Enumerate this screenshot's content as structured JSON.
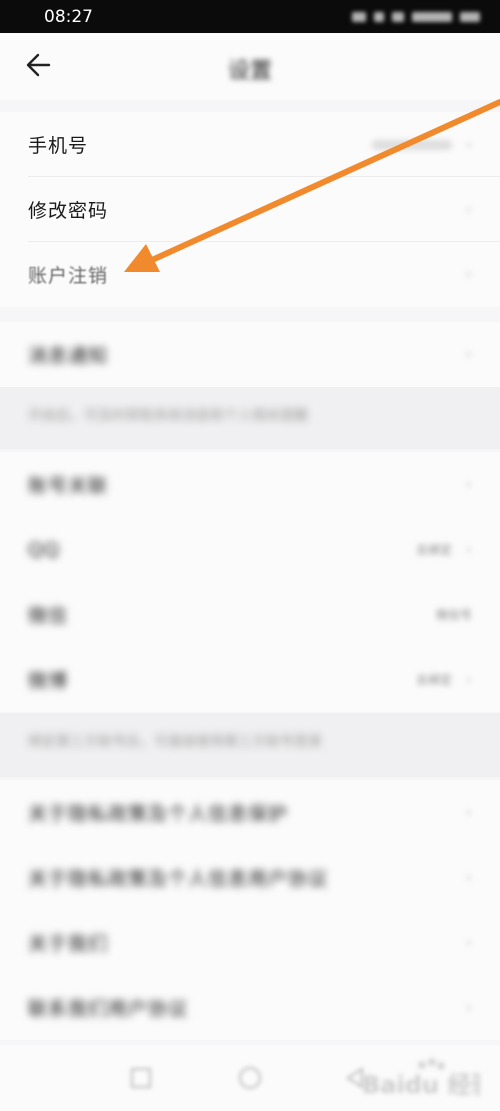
{
  "status_bar": {
    "time": "08:27"
  },
  "header": {
    "title": "设置"
  },
  "account": {
    "items": [
      {
        "label": "手机号",
        "value": "",
        "blurred": false,
        "faded": false
      },
      {
        "label": "修改密码",
        "value": "",
        "blurred": false,
        "faded": false
      },
      {
        "label": "账户注销",
        "value": "",
        "blurred": false,
        "faded": true
      }
    ]
  },
  "notifications": {
    "label": "消息通知"
  },
  "note1": "开启后，可及时获取系统消息和个人相关提醒",
  "bindings": {
    "items": [
      {
        "label": "账号关联",
        "value": ""
      },
      {
        "label": "QQ",
        "value": "去绑定"
      },
      {
        "label": "微信",
        "value": "微信号"
      },
      {
        "label": "微博",
        "value": "去绑定"
      }
    ]
  },
  "note2": "绑定第三方账号后，可直接使用第三方账号登录",
  "agreements": {
    "items": [
      {
        "label": "关于隐私政策及个人信息保护",
        "value": ""
      },
      {
        "label": "关于隐私政策及个人信息用户协议",
        "value": ""
      },
      {
        "label": "关于我们",
        "value": ""
      },
      {
        "label": "联系我们用户协议",
        "value": ""
      }
    ]
  },
  "watermark": {
    "text": "Baidu 经验"
  },
  "colors": {
    "accent_arrow": "#f08a2c",
    "background": "#f6f6f8",
    "card": "#fbfbfb"
  }
}
